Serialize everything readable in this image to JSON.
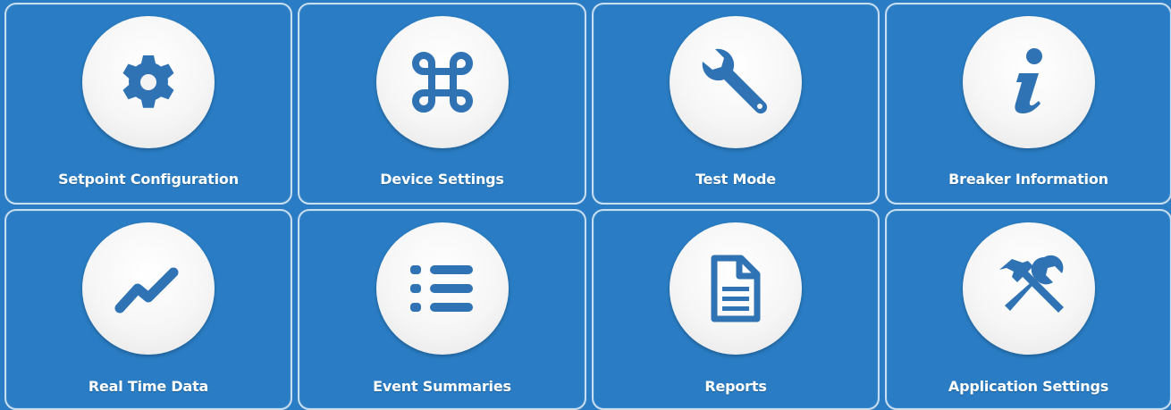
{
  "colors": {
    "tile_background": "#2a7dc4",
    "tile_border": "#c9def0",
    "icon_color": "#2f73b4",
    "label_color": "#ffffff"
  },
  "tiles": [
    {
      "label": "Setpoint Configuration",
      "icon": "gear-icon"
    },
    {
      "label": "Device Settings",
      "icon": "command-icon"
    },
    {
      "label": "Test Mode",
      "icon": "wrench-icon"
    },
    {
      "label": "Breaker Information",
      "icon": "info-icon"
    },
    {
      "label": "Real Time Data",
      "icon": "line-chart-icon"
    },
    {
      "label": "Event Summaries",
      "icon": "list-icon"
    },
    {
      "label": "Reports",
      "icon": "document-icon"
    },
    {
      "label": "Application Settings",
      "icon": "hammer-wrench-icon"
    }
  ]
}
